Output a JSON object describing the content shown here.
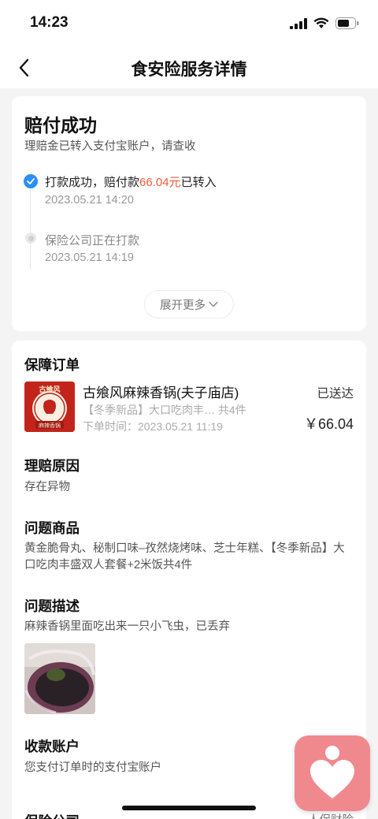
{
  "status_bar": {
    "time": "14:23"
  },
  "nav": {
    "title": "食安险服务详情"
  },
  "claim": {
    "title": "赔付成功",
    "subtitle": "理赔金已转入支付宝账户，请查收",
    "timeline": [
      {
        "text_prefix": "打款成功，赔付款",
        "amount": "66.04元",
        "text_suffix": "已转入",
        "time": "2023.05.21 14:20",
        "done": true
      },
      {
        "text": "保险公司正在打款",
        "time": "2023.05.21 14:19",
        "done": false
      }
    ],
    "expand_label": "展开更多"
  },
  "order": {
    "section_title": "保障订单",
    "store_name": "古飨风麻辣香锅(夫子庙店)",
    "status": "已送达",
    "items_summary": "【冬季新品】大口吃肉丰…  共4件",
    "order_time": "下单时间：2023.05.21 11:19",
    "price": "￥66.04",
    "logo_text_top": "古飨风",
    "logo_text_bottom": "麻辣香锅"
  },
  "reason": {
    "title": "理赔原因",
    "text": "存在异物"
  },
  "problem_items": {
    "title": "问题商品",
    "text": "黄金脆骨丸、秘制口味–孜然烧烤味、芝士年糕、【冬季新品】大口吃肉丰盛双人套餐+2米饭共4件"
  },
  "problem_desc": {
    "title": "问题描述",
    "text": "麻辣香锅里面吃出来一只小飞虫，已丢弃"
  },
  "payee": {
    "title": "收款账户",
    "text": "您支付订单时的支付宝账户"
  },
  "insurer": {
    "title": "保险公司",
    "value": "人保财险"
  },
  "colors": {
    "accent_blue": "#2a8ff7",
    "amount_red": "#f05a3a",
    "float_pink": "#f0898e"
  }
}
